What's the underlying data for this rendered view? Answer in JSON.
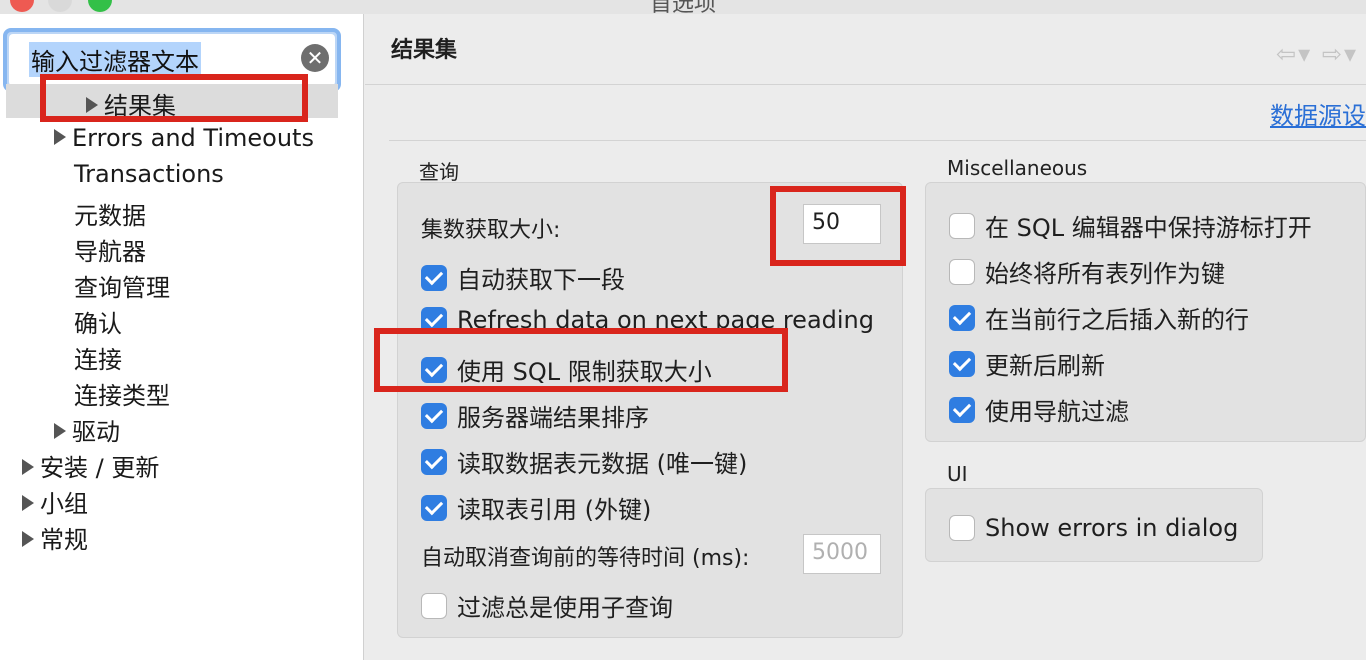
{
  "window": {
    "title": "首选项"
  },
  "search": {
    "value": "输入过滤器文本",
    "clear_icon": "✕"
  },
  "tree": {
    "selected": "结果集",
    "items": [
      {
        "label": "Errors and Timeouts"
      },
      {
        "label": "Transactions"
      },
      {
        "label": "元数据"
      },
      {
        "label": "导航器"
      },
      {
        "label": "查询管理"
      },
      {
        "label": "确认"
      },
      {
        "label": "连接"
      },
      {
        "label": "连接类型"
      },
      {
        "label": "驱动"
      },
      {
        "label": "安装 / 更新"
      },
      {
        "label": "小组"
      },
      {
        "label": "常规"
      }
    ]
  },
  "main": {
    "title": "结果集",
    "nav_arrows": "⇦▾ ⇨▾",
    "datasource_link": "数据源设"
  },
  "query": {
    "group_label": "查询",
    "fetch_size_label": "集数获取大小:",
    "fetch_size_value": "50",
    "checkboxes": [
      {
        "label": "自动获取下一段",
        "checked": true
      },
      {
        "label": "Refresh data on next page reading",
        "checked": true
      },
      {
        "label": "使用 SQL 限制获取大小",
        "checked": true
      },
      {
        "label": "服务器端结果排序",
        "checked": true
      },
      {
        "label": "读取数据表元数据 (唯一键)",
        "checked": true
      },
      {
        "label": "读取表引用 (外键)",
        "checked": true
      }
    ],
    "cancel_wait_label": "自动取消查询前的等待时间 (ms):",
    "cancel_wait_value": "5000",
    "subquery_label": "过滤总是使用子查询",
    "subquery_checked": false
  },
  "misc": {
    "group_label": "Miscellaneous",
    "checkboxes": [
      {
        "label": "在 SQL 编辑器中保持游标打开",
        "checked": false
      },
      {
        "label": "始终将所有表列作为键",
        "checked": false
      },
      {
        "label": "在当前行之后插入新的行",
        "checked": true
      },
      {
        "label": "更新后刷新",
        "checked": true
      },
      {
        "label": "使用导航过滤",
        "checked": true
      }
    ]
  },
  "ui": {
    "group_label": "UI",
    "show_errors_label": "Show errors in dialog",
    "show_errors_checked": false
  },
  "colors": {
    "accent": "#2f7de1",
    "highlight": "#d9251c",
    "link": "#2a6fd6"
  }
}
